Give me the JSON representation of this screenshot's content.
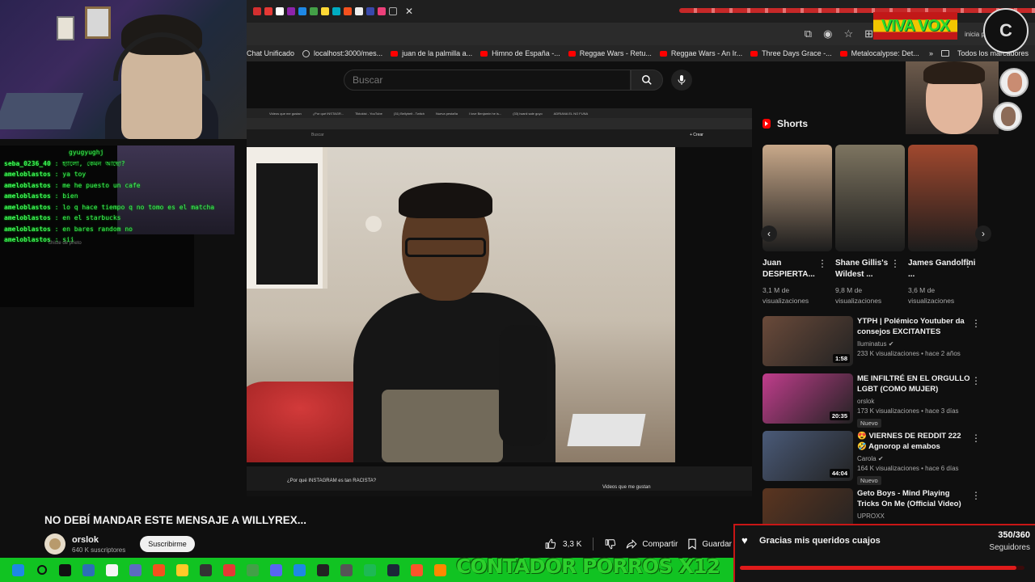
{
  "browser": {
    "bookmarks": [
      {
        "label": "Chat Unificado",
        "icon": "none"
      },
      {
        "label": "localhost:3000/mes...",
        "icon": "globe"
      },
      {
        "label": "juan de la palmilla a...",
        "icon": "youtube"
      },
      {
        "label": "Himno de España -...",
        "icon": "youtube"
      },
      {
        "label": "Reggae Wars - Retu...",
        "icon": "youtube"
      },
      {
        "label": "Reggae Wars - An Ir...",
        "icon": "youtube"
      },
      {
        "label": "Three Days Grace -...",
        "icon": "youtube"
      },
      {
        "label": "Metalocalypse: Det...",
        "icon": "youtube"
      }
    ],
    "bookmarks_more": "»",
    "all_bookmarks": "Todos los marcadores",
    "toolbar_partial_text": "inicia par"
  },
  "youtube": {
    "search_placeholder": "Buscar",
    "video": {
      "title": "NO DEBÍ MANDAR ESTE MENSAJE A WILLYREX...",
      "channel": "orslok",
      "subscribers": "640 K suscriptores",
      "subscribe_label": "Suscribirme",
      "likes": "3,3 K",
      "share_label": "Compartir",
      "save_label": "Guardar"
    },
    "inner_screen": {
      "search_placeholder": "Buscar",
      "create_label": "+ Crear",
      "video_title": "¿Por qué INSTAGRAM es tan RACISTA?",
      "sidebar_title": "Videos que me gustan",
      "tabs": [
        "Videos que me gustan",
        "¿Por qué INSTAGR...",
        "Tiktokist - YouTube",
        "(31) Bellybelt - Twitch",
        "Nueva pestaña",
        "I love Benjamin he is...",
        "(33) lwanii sale guyo",
        "ADRIANA EL NO FUNA"
      ]
    },
    "shorts_heading": "Shorts",
    "shorts": [
      {
        "title": "Juan DESPIERTA...",
        "views": "3,1 M de visualizaciones",
        "color": "#c9a98a"
      },
      {
        "title": "Shane Gillis's Wildest ...",
        "views": "9,8 M de visualizaciones",
        "color": "#7d7460"
      },
      {
        "title": "James Gandolfini ...",
        "views": "3,6 M de visualizaciones",
        "color": "#a1482e"
      }
    ],
    "videos": [
      {
        "title": "YTPH | Polémico Youtuber da consejos EXCITANTES",
        "channel": "Iluminatus",
        "verified": true,
        "stats": "233 K visualizaciones • hace 2 años",
        "duration": "1:58",
        "badge": "",
        "color": "#6a4a3a"
      },
      {
        "title": "ME INFILTRÉ EN EL ORGULLO LGBT (COMO MUJER)",
        "channel": "orslok",
        "verified": false,
        "stats": "173 K visualizaciones • hace 3 días",
        "duration": "20:35",
        "badge": "Nuevo",
        "color": "#c03d8c"
      },
      {
        "title": "😍 VIERNES DE REDDIT 222 🤣 Agnorop al emabos",
        "channel": "Carola",
        "verified": true,
        "stats": "164 K visualizaciones • hace 6 días",
        "duration": "44:04",
        "badge": "Nuevo",
        "color": "#4a5a78"
      },
      {
        "title": "Geto Boys - Mind Playing Tricks On Me (Official Video) [Explicit]",
        "channel": "UPROXX",
        "verified": false,
        "stats": "",
        "duration": "",
        "badge": "",
        "color": "#5b3520"
      }
    ]
  },
  "stream_overlay": {
    "chat": [
      {
        "user": "",
        "msg": "gyugyughj"
      },
      {
        "user": "seba_0236_40",
        "msg": "হ্যালো, কেমন আছো?"
      },
      {
        "user": "ameloblastos",
        "msg": "ya toy"
      },
      {
        "user": "ameloblastos",
        "msg": "me he puesto un cafe"
      },
      {
        "user": "ameloblastos",
        "msg": "bien"
      },
      {
        "user": "ameloblastos",
        "msg": "lo q hace tiempo q no tomo es el matcha"
      },
      {
        "user": "ameloblastos",
        "msg": "en el starbucks"
      },
      {
        "user": "ameloblastos",
        "msg": "en bares random no"
      },
      {
        "user": "ameloblastos",
        "msg": "sii"
      }
    ],
    "faded_chat_note": "chiste de prieto",
    "viva_text": "VIVA VOX",
    "logo_text": "C",
    "counter_text": "CONTADOR PORROS X12",
    "goal": {
      "message": "Gracias mis queridos cuajos",
      "count_text": "350/360",
      "label": "Seguidores",
      "progress": 0.972
    }
  },
  "taskbar": {
    "icons": [
      "windows-logo",
      "search",
      "capcut",
      "visual-studio",
      "notes",
      "brave",
      "vortex",
      "folder",
      "obs",
      "chrome",
      "vortex-app",
      "discord",
      "vscode",
      "epic",
      "unity",
      "spotify",
      "steam",
      "brave-alt",
      "vlc"
    ]
  },
  "colors": {
    "yt_bg": "#0f0f0f",
    "yt_red": "#ff0000",
    "chat_green": "#3ef15a",
    "taskbar_green": "#11c322",
    "goal_red": "#e01b1b"
  }
}
